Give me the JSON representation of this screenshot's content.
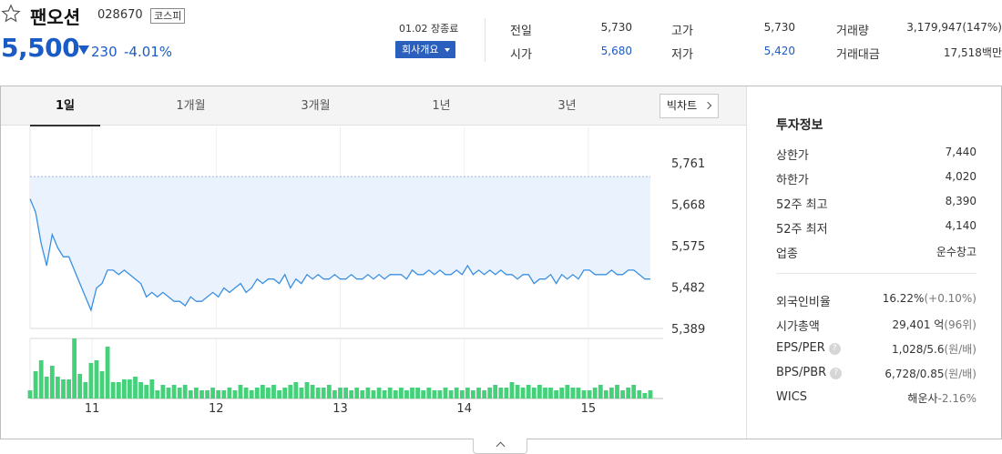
{
  "stock": {
    "name": "팬오션",
    "code": "028670",
    "market": "코스피",
    "price": "5,500",
    "change": "230",
    "change_rate": "-4.01%",
    "close_date": "01.02 장종료",
    "overview_label": "회사개요"
  },
  "quotes": {
    "prev_close": {
      "label": "전일",
      "value": "5,730"
    },
    "open": {
      "label": "시가",
      "value": "5,680"
    },
    "high": {
      "label": "고가",
      "value": "5,730"
    },
    "low": {
      "label": "저가",
      "value": "5,420"
    },
    "volume": {
      "label": "거래량",
      "value": "3,179,947(147%)"
    },
    "amount": {
      "label": "거래대금",
      "value": "17,518백만"
    }
  },
  "tabs": [
    {
      "label": "1일",
      "active": true
    },
    {
      "label": "1개월",
      "active": false
    },
    {
      "label": "3개월",
      "active": false
    },
    {
      "label": "1년",
      "active": false
    },
    {
      "label": "3년",
      "active": false
    }
  ],
  "bigchart_label": "빅차트",
  "colors": {
    "down": "#1b5bc5",
    "up": "#e03131",
    "line": "#3a8fe0",
    "area": "#eaf3fd",
    "volume": "#45d17a"
  },
  "chart_data": {
    "type": "line",
    "title": "",
    "xlabel": "",
    "ylabel": "",
    "ylim": [
      5389,
      5761
    ],
    "yticks": [
      "5,761",
      "5,668",
      "5,575",
      "5,482",
      "5,389"
    ],
    "ytick_values": [
      5761,
      5668,
      5575,
      5482,
      5389
    ],
    "xticks": [
      "11",
      "12",
      "13",
      "14",
      "15"
    ],
    "xtick_positions": [
      10,
      30,
      50,
      70,
      90
    ],
    "reference_price": 5730,
    "x": [
      0,
      1,
      2,
      3,
      4,
      5,
      6,
      7,
      8,
      9,
      10,
      11,
      12,
      13,
      14,
      15,
      16,
      17,
      18,
      19,
      20,
      21,
      22,
      23,
      24,
      25,
      26,
      27,
      28,
      29,
      30,
      31,
      32,
      33,
      34,
      35,
      36,
      37,
      38,
      39,
      40,
      41,
      42,
      43,
      44,
      45,
      46,
      47,
      48,
      49,
      50,
      51,
      52,
      53,
      54,
      55,
      56,
      57,
      58,
      59,
      60,
      61,
      62,
      63,
      64,
      65,
      66,
      67,
      68,
      69,
      70,
      71,
      72,
      73,
      74,
      75,
      76,
      77,
      78,
      79,
      80,
      81,
      82,
      83,
      84,
      85,
      86,
      87,
      88,
      89,
      90,
      91,
      92,
      93,
      94,
      95,
      96,
      97,
      98,
      99,
      100,
      101,
      102,
      103,
      104,
      105,
      106,
      107,
      108,
      109,
      110,
      111,
      112
    ],
    "price": [
      5680,
      5650,
      5580,
      5530,
      5600,
      5570,
      5550,
      5550,
      5520,
      5490,
      5460,
      5430,
      5480,
      5490,
      5520,
      5520,
      5510,
      5520,
      5510,
      5500,
      5490,
      5460,
      5470,
      5460,
      5470,
      5460,
      5450,
      5450,
      5440,
      5460,
      5450,
      5450,
      5460,
      5470,
      5460,
      5480,
      5470,
      5480,
      5490,
      5470,
      5480,
      5500,
      5490,
      5500,
      5500,
      5490,
      5510,
      5480,
      5500,
      5490,
      5510,
      5500,
      5510,
      5500,
      5500,
      5510,
      5500,
      5500,
      5510,
      5500,
      5500,
      5510,
      5500,
      5510,
      5500,
      5510,
      5510,
      5510,
      5500,
      5520,
      5510,
      5510,
      5520,
      5510,
      5520,
      5510,
      5510,
      5520,
      5510,
      5530,
      5510,
      5520,
      5510,
      5520,
      5510,
      5520,
      5510,
      5510,
      5500,
      5510,
      5510,
      5490,
      5500,
      5500,
      5510,
      5490,
      5510,
      5500,
      5510,
      5500,
      5520,
      5520,
      5510,
      5510,
      5510,
      5520,
      5510,
      5510,
      5520,
      5520,
      5510,
      5500,
      5500
    ],
    "volume": [
      3,
      10,
      14,
      8,
      12,
      8,
      7,
      7,
      22,
      9,
      6,
      13,
      14,
      10,
      19,
      6,
      6,
      7,
      7,
      8,
      6,
      5,
      7,
      3,
      5,
      4,
      5,
      4,
      5,
      3,
      4,
      3,
      3,
      4,
      3,
      3,
      4,
      3,
      5,
      4,
      3,
      4,
      5,
      4,
      5,
      3,
      4,
      5,
      6,
      4,
      6,
      5,
      4,
      4,
      5,
      3,
      4,
      4,
      3,
      4,
      3,
      4,
      3,
      4,
      3,
      4,
      3,
      4,
      3,
      4,
      4,
      3,
      4,
      3,
      3,
      4,
      3,
      4,
      3,
      4,
      3,
      4,
      3,
      4,
      5,
      4,
      4,
      6,
      5,
      4,
      5,
      4,
      5,
      4,
      4,
      3,
      4,
      5,
      4,
      4,
      3,
      3,
      4,
      5,
      3,
      4,
      5,
      3,
      4,
      5,
      3,
      2,
      3
    ]
  },
  "investment": {
    "title": "투자정보",
    "rows": [
      {
        "label": "상한가",
        "value": "7,440",
        "color": "red"
      },
      {
        "label": "하한가",
        "value": "4,020",
        "color": "blue"
      },
      {
        "label": "52주 최고",
        "value": "8,390",
        "color": ""
      },
      {
        "label": "52주 최저",
        "value": "4,140",
        "color": ""
      },
      {
        "label": "업종",
        "value": "운수창고",
        "color": ""
      }
    ],
    "rows2": [
      {
        "label": "외국인비율",
        "value": "16.22%",
        "sub": "(+0.10%)",
        "help": false
      },
      {
        "label": "시가총액",
        "value": "29,401 억",
        "sub": "(96위)",
        "help": false
      },
      {
        "label": "EPS/PER",
        "value": "1,028/5.6",
        "sub": "(원/배)",
        "help": true
      },
      {
        "label": "BPS/PBR",
        "value": "6,728/0.85",
        "sub": "(원/배)",
        "help": true
      },
      {
        "label": "WICS",
        "value": "해운사",
        "sub": "-2.16%",
        "help": false
      }
    ]
  }
}
